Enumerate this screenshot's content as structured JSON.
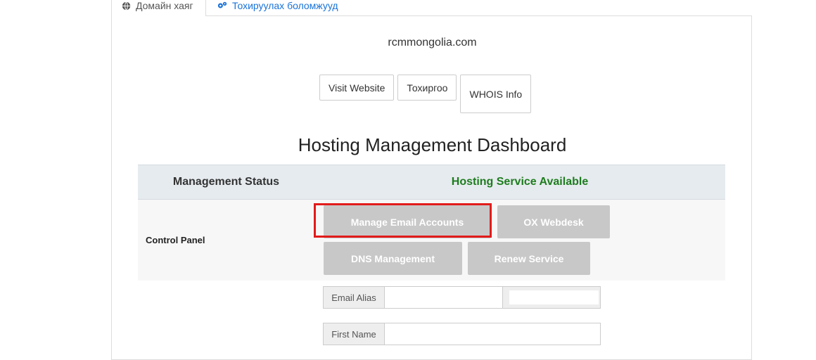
{
  "tabs": [
    {
      "label": "Домайн хаяг",
      "icon": "globe-icon"
    },
    {
      "label": "Тохируулах боломжууд",
      "icon": "cogs-icon"
    }
  ],
  "domain": "rcmmongolia.com",
  "actions": {
    "visit": "Visit Website",
    "settings": "Тохиргоо",
    "whois": "WHOIS Info"
  },
  "dashboard": {
    "title": "Hosting Management Dashboard",
    "status_label": "Management Status",
    "status_value": "Hosting Service Available",
    "status_color": "#1e7c1e",
    "control_panel_label": "Control Panel",
    "buttons": {
      "manage_email": "Manage Email Accounts",
      "ox_webdesk": "OX Webdesk",
      "dns": "DNS Management",
      "renew": "Renew Service"
    }
  },
  "form": {
    "email_alias_label": "Email Alias",
    "email_alias_value": "",
    "first_name_label": "First Name",
    "first_name_value": ""
  },
  "colors": {
    "highlight": "#e21b1b",
    "disabled_button": "#c8c8c8",
    "link": "#1a73d8"
  }
}
